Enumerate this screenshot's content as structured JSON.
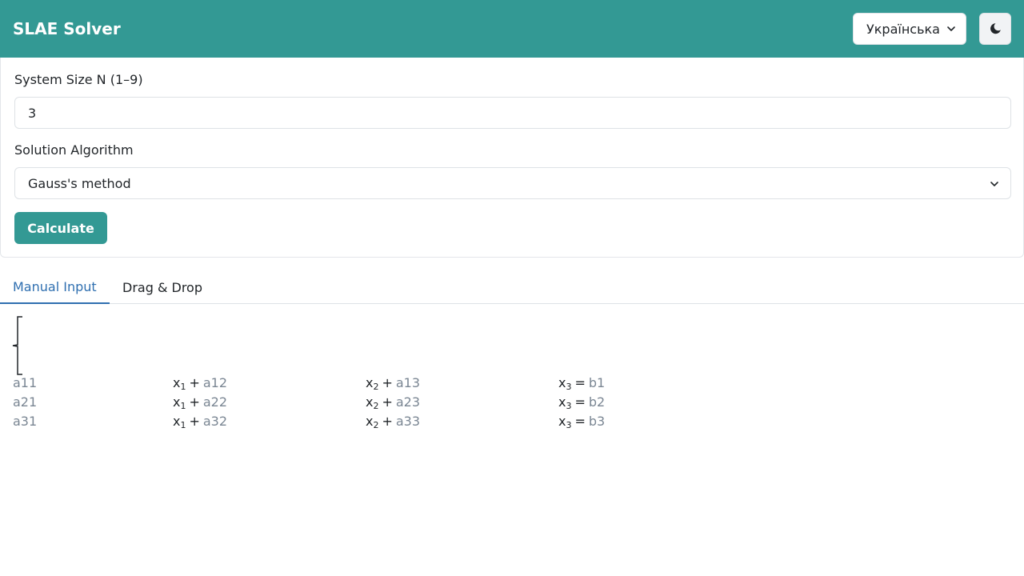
{
  "app": {
    "title": "SLAE Solver",
    "language": "Українська",
    "accent_color": "#339994"
  },
  "theme_toggle": {
    "icon": "moon-icon"
  },
  "form": {
    "size_label": "System Size N (1–9)",
    "size_value": "3",
    "algorithm_label": "Solution Algorithm",
    "algorithm_value": "Gauss's method",
    "calculate_label": "Calculate"
  },
  "tabs": [
    {
      "label": "Manual Input",
      "active": true
    },
    {
      "label": "Drag & Drop",
      "active": false
    }
  ],
  "equations": [
    {
      "c1": "a11",
      "v1": "x",
      "s1": "1",
      "c2": "a12",
      "v2": "x",
      "s2": "2",
      "c3": "a13",
      "v3": "x",
      "s3": "3",
      "rhs": "b1"
    },
    {
      "c1": "a21",
      "v1": "x",
      "s1": "1",
      "c2": "a22",
      "v2": "x",
      "s2": "2",
      "c3": "a23",
      "v3": "x",
      "s3": "3",
      "rhs": "b2"
    },
    {
      "c1": "a31",
      "v1": "x",
      "s1": "1",
      "c2": "a32",
      "v2": "x",
      "s2": "2",
      "c3": "a33",
      "v3": "x",
      "s3": "3",
      "rhs": "b3"
    }
  ],
  "symbols": {
    "plus": "+",
    "equals": "="
  }
}
